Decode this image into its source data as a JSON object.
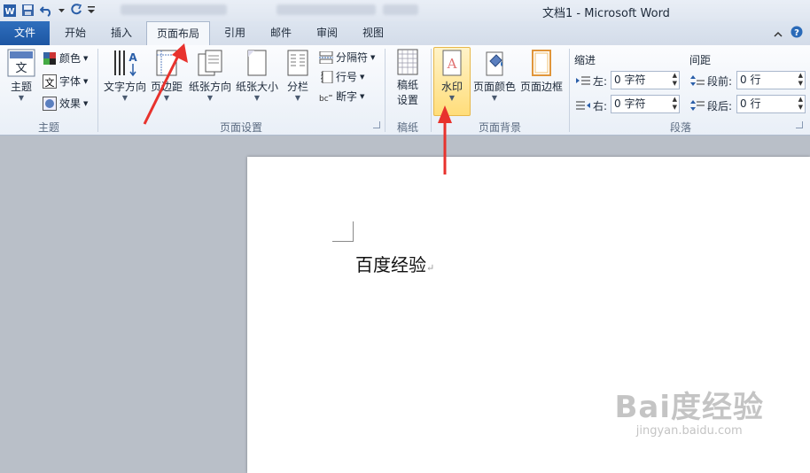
{
  "window": {
    "title": "文档1  -  Microsoft Word"
  },
  "tabs": [
    {
      "label": "文件"
    },
    {
      "label": "开始"
    },
    {
      "label": "插入"
    },
    {
      "label": "页面布局"
    },
    {
      "label": "引用"
    },
    {
      "label": "邮件"
    },
    {
      "label": "审阅"
    },
    {
      "label": "视图"
    }
  ],
  "ribbon": {
    "theme": {
      "button": "主题",
      "colors": "颜色",
      "fonts": "字体",
      "effects": "效果",
      "group": "主题"
    },
    "page_setup": {
      "text_direction": "文字方向",
      "margins": "页边距",
      "orientation": "纸张方向",
      "size": "纸张大小",
      "columns": "分栏",
      "breaks": "分隔符",
      "line_numbers": "行号",
      "hyphenation": "断字",
      "group": "页面设置"
    },
    "manuscript": {
      "button_line1": "稿纸",
      "button_line2": "设置",
      "group": "稿纸"
    },
    "page_background": {
      "watermark": "水印",
      "page_color": "页面颜色",
      "page_borders": "页面边框",
      "group": "页面背景"
    },
    "paragraph": {
      "indent": "缩进",
      "spacing": "间距",
      "left": "左:",
      "right": "右:",
      "before": "段前:",
      "after": "段后:",
      "left_value": "0 字符",
      "right_value": "0 字符",
      "before_value": "0 行",
      "after_value": "0 行",
      "group": "段落"
    }
  },
  "document": {
    "text": "百度经验",
    "mark": "↵"
  },
  "watermark": {
    "logo": "Bai度经验",
    "url": "jingyan.baidu.com"
  },
  "colors": {
    "accent": "#2a6ab8",
    "highlight": "#ffdd7a",
    "arrow": "#e8322d"
  }
}
